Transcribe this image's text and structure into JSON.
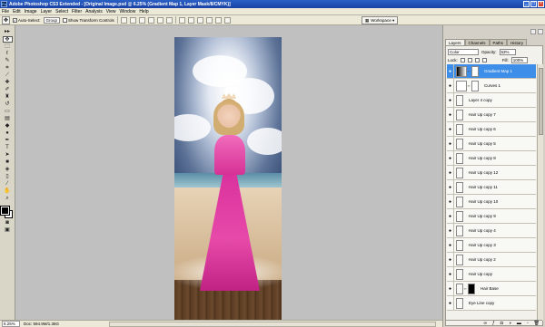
{
  "window": {
    "title": "Adobe Photoshop CS3 Extended - [Original Image.psd @ 6.25% (Gradient Map 1, Layer Mask/8/CMYK)]",
    "logo": "Ps",
    "controls": {
      "minimize": "_",
      "maximize": "□",
      "close": "×"
    }
  },
  "menu": [
    "File",
    "Edit",
    "Image",
    "Layer",
    "Select",
    "Filter",
    "Analysis",
    "View",
    "Window",
    "Help"
  ],
  "options": {
    "auto_select_label": "Auto-Select:",
    "auto_select_value": "Group",
    "show_transform_label": "Show Transform Controls",
    "workspace_label": "Workspace ▾"
  },
  "status": {
    "zoom": "6.25%",
    "doc": "Doc: 594.9M/1.36G"
  },
  "panel": {
    "tabs": [
      "Layers",
      "Channels",
      "Paths",
      "History"
    ],
    "blend_mode": "Color",
    "opacity_label": "Opacity:",
    "opacity_value": "53%",
    "lock_label": "Lock:",
    "fill_label": "Fill:",
    "fill_value": "100%",
    "layers": [
      {
        "name": "Gradient Map 1",
        "kind": "gradient-map",
        "selected": true
      },
      {
        "name": "Curves 1",
        "kind": "curves",
        "selected": false
      },
      {
        "name": "Layer 4 copy",
        "kind": "normal",
        "selected": false
      },
      {
        "name": "Hair Up copy 7",
        "kind": "normal",
        "selected": false
      },
      {
        "name": "Hair Up copy 6",
        "kind": "normal",
        "selected": false
      },
      {
        "name": "Hair Up copy 5",
        "kind": "normal",
        "selected": false
      },
      {
        "name": "Hair Up copy 8",
        "kind": "normal",
        "selected": false
      },
      {
        "name": "Hair Up copy 12",
        "kind": "normal",
        "selected": false
      },
      {
        "name": "Hair Up copy 11",
        "kind": "normal",
        "selected": false
      },
      {
        "name": "Hair Up copy 10",
        "kind": "normal",
        "selected": false
      },
      {
        "name": "Hair Up copy 9",
        "kind": "normal",
        "selected": false
      },
      {
        "name": "Hair Up copy 4",
        "kind": "normal",
        "selected": false
      },
      {
        "name": "Hair Up copy 3",
        "kind": "normal",
        "selected": false
      },
      {
        "name": "Hair Up copy 2",
        "kind": "normal",
        "selected": false
      },
      {
        "name": "Hair Up copy",
        "kind": "normal",
        "selected": false
      },
      {
        "name": "Hair Base",
        "kind": "masked",
        "selected": false
      },
      {
        "name": "Eye Line copy",
        "kind": "normal",
        "selected": false
      }
    ]
  },
  "colors": {
    "selection": "#3d8ee8",
    "titlebar": "#1941a5",
    "canvas_bg": "#c0c0c0"
  }
}
